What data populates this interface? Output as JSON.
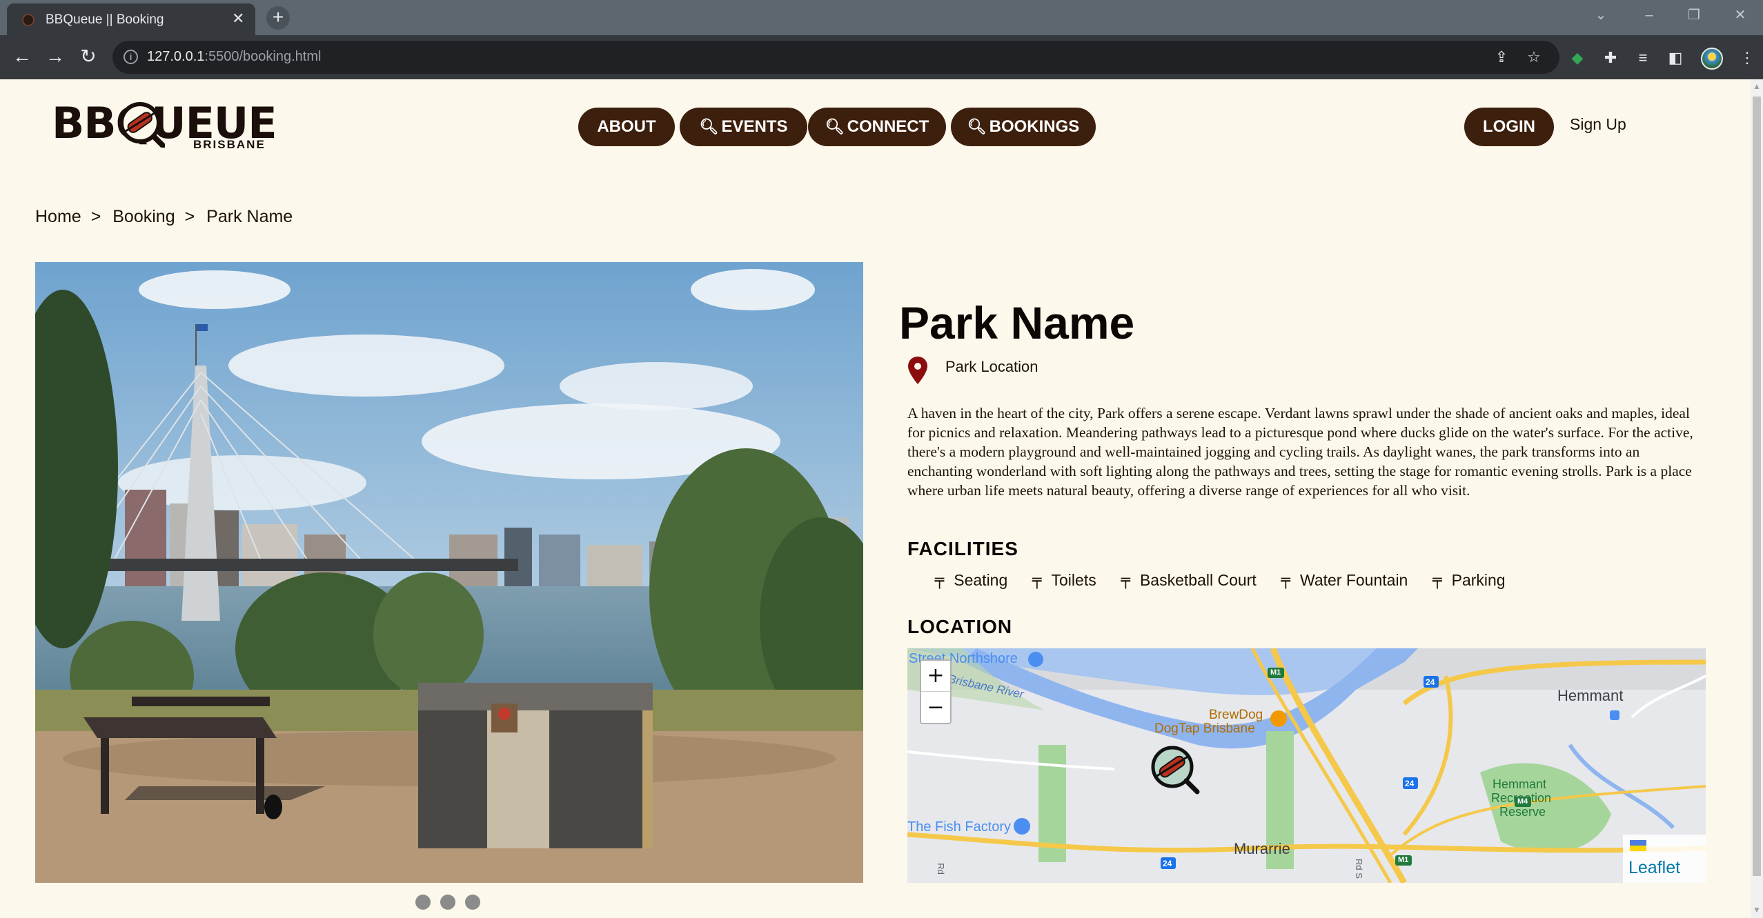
{
  "browser": {
    "tab_title": "BBQueue || Booking",
    "url_host": "127.0.0.1",
    "url_path": ":5500/booking.html"
  },
  "site": {
    "logo_text": "BBQUEUE",
    "logo_sub": "BRISBANE",
    "nav": [
      "ABOUT",
      "EVENTS",
      "CONNECT",
      "BOOKINGS"
    ],
    "login": "LOGIN",
    "signup": "Sign Up",
    "accent_color": "#3d1f0d"
  },
  "breadcrumb": [
    "Home",
    "Booking",
    "Park Name"
  ],
  "park": {
    "name": "Park Name",
    "location": "Park Location",
    "description": "A haven in the heart of the city, Park offers a serene escape. Verdant lawns sprawl under the shade of ancient oaks and maples, ideal for picnics and relaxation. Meandering pathways lead to a picturesque pond where ducks glide on the water's surface. For the active, there's a modern playground and well-maintained jogging and cycling trails. As daylight wanes, the park transforms into an enchanting wonderland with soft lighting along the pathways and trees, setting the stage for romantic evening strolls. Park is a place where urban life meets natural beauty, offering a diverse range of experiences for all who visit.",
    "facilities_heading": "FACILITIES",
    "facilities": [
      "Seating",
      "Toilets",
      "Basketball Court",
      "Water Fountain",
      "Parking"
    ],
    "location_heading": "LOCATION",
    "carousel_count": 3
  },
  "map": {
    "zoom_in": "+",
    "zoom_out": "−",
    "attribution": "Leaflet",
    "labels": {
      "northshore": "Street Northshore",
      "river": "Brisbane River",
      "brewdog1": "BrewDog",
      "brewdog2": "DogTap Brisbane",
      "hemmant": "Hemmant",
      "reserve1": "Hemmant",
      "reserve2": "Recreation",
      "reserve3": "Reserve",
      "fish": "The Fish Factory",
      "murarrie": "Murarrie",
      "m1a": "M1",
      "m1b": "M1",
      "r24a": "24",
      "r24b": "24",
      "r24c": "24",
      "m4": "M4",
      "rd1": "Rd",
      "rd2": "Rd S"
    }
  }
}
